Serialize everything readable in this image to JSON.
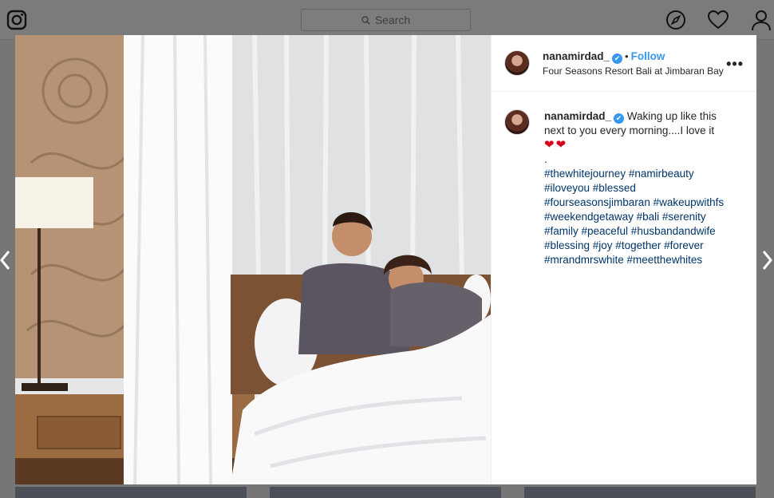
{
  "search": {
    "placeholder": "Search"
  },
  "post": {
    "username": "nanamirdad_",
    "verified_mark": "✔",
    "separator": "•",
    "follow_label": "Follow",
    "location": "Four Seasons Resort Bali at Jimbaran Bay",
    "more_label": "•••",
    "caption_text": "Waking up like this next to you every morning....I love it",
    "hearts": "❤❤",
    "period": ".",
    "hashtag_lines": [
      "#thewhitejourney #namirbeauty",
      "#iloveyou #blessed",
      "#fourseasonsjimbaran #wakeupwithfs",
      "#weekendgetaway #bali #serenity",
      "#family #peaceful #husbandandwife",
      "#blessing #joy #together #forever",
      "#mrandmrswhite #meetthewhites"
    ]
  },
  "icons": {
    "logo": "instagram-icon",
    "explore": "compass-icon",
    "activity": "heart-icon",
    "profile": "user-icon",
    "prev": "chevron-left-icon",
    "next": "chevron-right-icon"
  }
}
